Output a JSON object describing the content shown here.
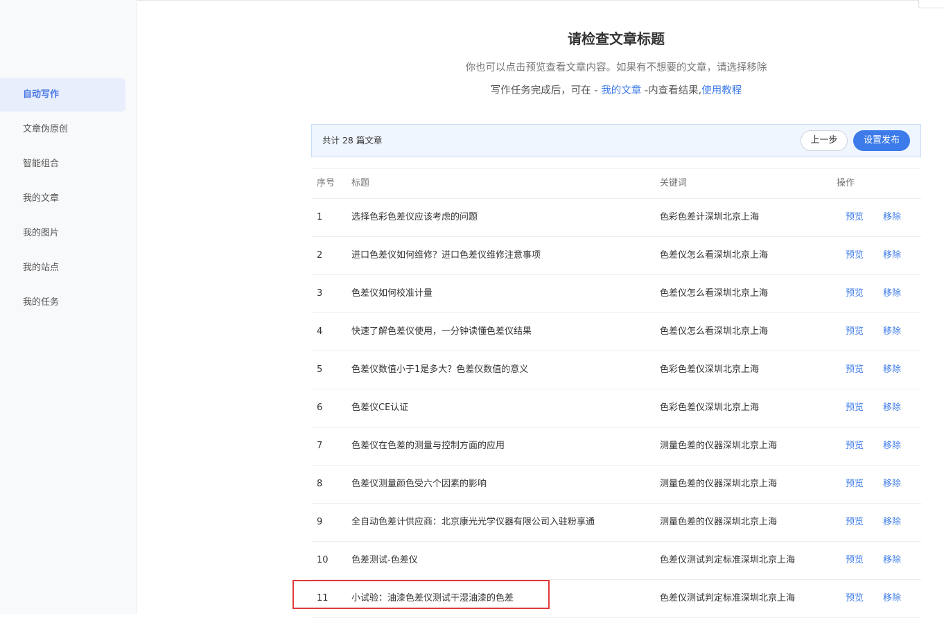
{
  "sidebar": {
    "items": [
      {
        "label": "自动写作",
        "active": true
      },
      {
        "label": "文章伪原创",
        "active": false
      },
      {
        "label": "智能组合",
        "active": false
      },
      {
        "label": "我的文章",
        "active": false
      },
      {
        "label": "我的图片",
        "active": false
      },
      {
        "label": "我的站点",
        "active": false
      },
      {
        "label": "我的任务",
        "active": false
      }
    ]
  },
  "header": {
    "title": "请检查文章标题",
    "subtitle": "你也可以点击预览查看文章内容。如果有不想要的文章，请选择移除",
    "hint_prefix": "写作任务完成后，可在 - ",
    "hint_link": "我的文章",
    "hint_middle": " -内查看结果,",
    "hint_tutorial": "使用教程"
  },
  "summary": {
    "text": "共计 28 篇文章",
    "prev_label": "上一步",
    "publish_label": "设置发布"
  },
  "table": {
    "columns": {
      "no": "序号",
      "title": "标题",
      "keyword": "关键词",
      "action": "操作"
    },
    "preview_label": "预览",
    "remove_label": "移除",
    "rows": [
      {
        "no": "1",
        "title": "选择色彩色差仪应该考虑的问题",
        "keyword": "色彩色差计深圳北京上海"
      },
      {
        "no": "2",
        "title": "进口色差仪如何维修？进口色差仪维修注意事项",
        "keyword": "色差仪怎么看深圳北京上海"
      },
      {
        "no": "3",
        "title": "色差仪如何校准计量",
        "keyword": "色差仪怎么看深圳北京上海"
      },
      {
        "no": "4",
        "title": "快速了解色差仪使用，一分钟读懂色差仪结果",
        "keyword": "色差仪怎么看深圳北京上海"
      },
      {
        "no": "5",
        "title": "色差仪数值小于1是多大？色差仪数值的意义",
        "keyword": "色彩色差仪深圳北京上海"
      },
      {
        "no": "6",
        "title": "色差仪CE认证",
        "keyword": "色彩色差仪深圳北京上海"
      },
      {
        "no": "7",
        "title": "色差仪在色差的测量与控制方面的应用",
        "keyword": "测量色差的仪器深圳北京上海"
      },
      {
        "no": "8",
        "title": "色差仪测量颜色受六个因素的影响",
        "keyword": "测量色差的仪器深圳北京上海"
      },
      {
        "no": "9",
        "title": "全自动色差计供应商：北京康光光学仪器有限公司入驻粉享通",
        "keyword": "测量色差的仪器深圳北京上海"
      },
      {
        "no": "10",
        "title": "色差测试-色差仪",
        "keyword": "色差仪测试判定标准深圳北京上海"
      },
      {
        "no": "11",
        "title": "小试验：油漆色差仪测试干湿油漆的色差",
        "keyword": "色差仪测试判定标准深圳北京上海"
      }
    ]
  },
  "colors": {
    "accent": "#3d7bea",
    "active_nav_bg": "#e8eefb",
    "highlight_border": "#e03a3a",
    "summary_bg": "#f0f6ff"
  }
}
